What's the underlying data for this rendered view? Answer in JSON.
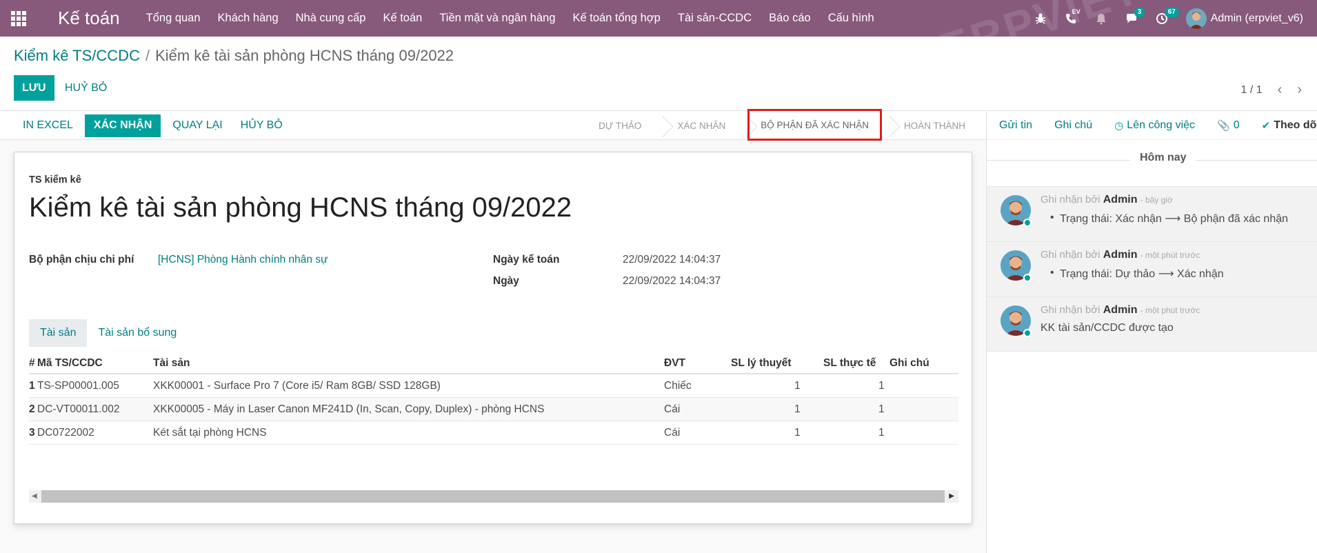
{
  "nav": {
    "brand": "Kế toán",
    "menu": [
      "Tổng quan",
      "Khách hàng",
      "Nhà cung cấp",
      "Kế toán",
      "Tiền mặt và ngân hàng",
      "Kế toán tổng hợp",
      "Tài sản-CCDC",
      "Báo cáo",
      "Cấu hình"
    ],
    "phone_superscript": "EV",
    "messages_badge": "3",
    "activities_badge": "67",
    "user": "Admin (erpviet_v6)",
    "watermark": "ERPVIET"
  },
  "breadcrumb": {
    "parent": "Kiểm kê TS/CCDC",
    "separator": "/",
    "current": "Kiểm kê tài sản phòng HCNS tháng 09/2022"
  },
  "actions": {
    "save": "LƯU",
    "discard": "HUỶ BỎ"
  },
  "pager": {
    "value": "1 / 1"
  },
  "statusbar": {
    "buttons": [
      "IN EXCEL",
      "XÁC NHẬN",
      "QUAY LẠI",
      "HỦY BỎ"
    ],
    "stages": [
      "DỰ THẢO",
      "XÁC NHẬN",
      "BỘ PHẬN ĐÃ XÁC NHẬN",
      "HOÀN THÀNH"
    ],
    "current_stage": "BỘ PHẬN ĐÃ XÁC NHẬN"
  },
  "form": {
    "type_label": "TS kiểm kê",
    "title": "Kiểm kê tài sản phòng HCNS tháng 09/2022",
    "fields": {
      "cost_dept_label": "Bộ phận chịu chi phí",
      "cost_dept_value": "[HCNS] Phòng Hành chính nhân sự",
      "acc_date_label": "Ngày kế toán",
      "acc_date_value": "22/09/2022 14:04:37",
      "date_label": "Ngày",
      "date_value": "22/09/2022 14:04:37"
    },
    "tabs": [
      "Tài sản",
      "Tài sản bổ sung"
    ],
    "table": {
      "columns": [
        "#",
        "Mã TS/CCDC",
        "Tài sản",
        "ĐVT",
        "SL lý thuyết",
        "SL thực tế",
        "Ghi chú"
      ],
      "rows": [
        {
          "no": "1",
          "code": "TS-SP00001.005",
          "asset": "XKK00001 - Surface Pro 7 (Core i5/ Ram 8GB/ SSD 128GB)",
          "unit": "Chiếc",
          "qty_theory": "1",
          "qty_actual": "1",
          "note": ""
        },
        {
          "no": "2",
          "code": "DC-VT00011.002",
          "asset": "XKK00005 - Máy in Laser Canon MF241D (In, Scan, Copy, Duplex) - phòng HCNS",
          "unit": "Cái",
          "qty_theory": "1",
          "qty_actual": "1",
          "note": ""
        },
        {
          "no": "3",
          "code": "DC0722002",
          "asset": "Két sắt tại phòng HCNS",
          "unit": "Cái",
          "qty_theory": "1",
          "qty_actual": "1",
          "note": ""
        }
      ]
    }
  },
  "chatter": {
    "send_message": "Gửi tin",
    "log_note": "Ghi chú",
    "schedule_activity": "Lên công việc",
    "attachments": "0",
    "follow": "Theo dõi",
    "today": "Hôm nay",
    "messages": [
      {
        "prefix": "Ghi nhận bởi",
        "author": "Admin",
        "time": "- bây giờ",
        "text": "Trạng thái: Xác nhận ⟶ Bộ phận đã xác nhận",
        "bullet": true
      },
      {
        "prefix": "Ghi nhận bởi",
        "author": "Admin",
        "time": "- một phút trước",
        "text": "Trạng thái: Dự thảo ⟶ Xác nhận",
        "bullet": true
      },
      {
        "prefix": "Ghi nhận bởi",
        "author": "Admin",
        "time": "- một phút trước",
        "text": "KK tài sản/CCDC được tạo",
        "bullet": false
      }
    ]
  },
  "colors": {
    "navbar": "#875a7b",
    "accent": "#00a09d",
    "link": "#017e84",
    "highlight_border": "#e21b1b"
  }
}
